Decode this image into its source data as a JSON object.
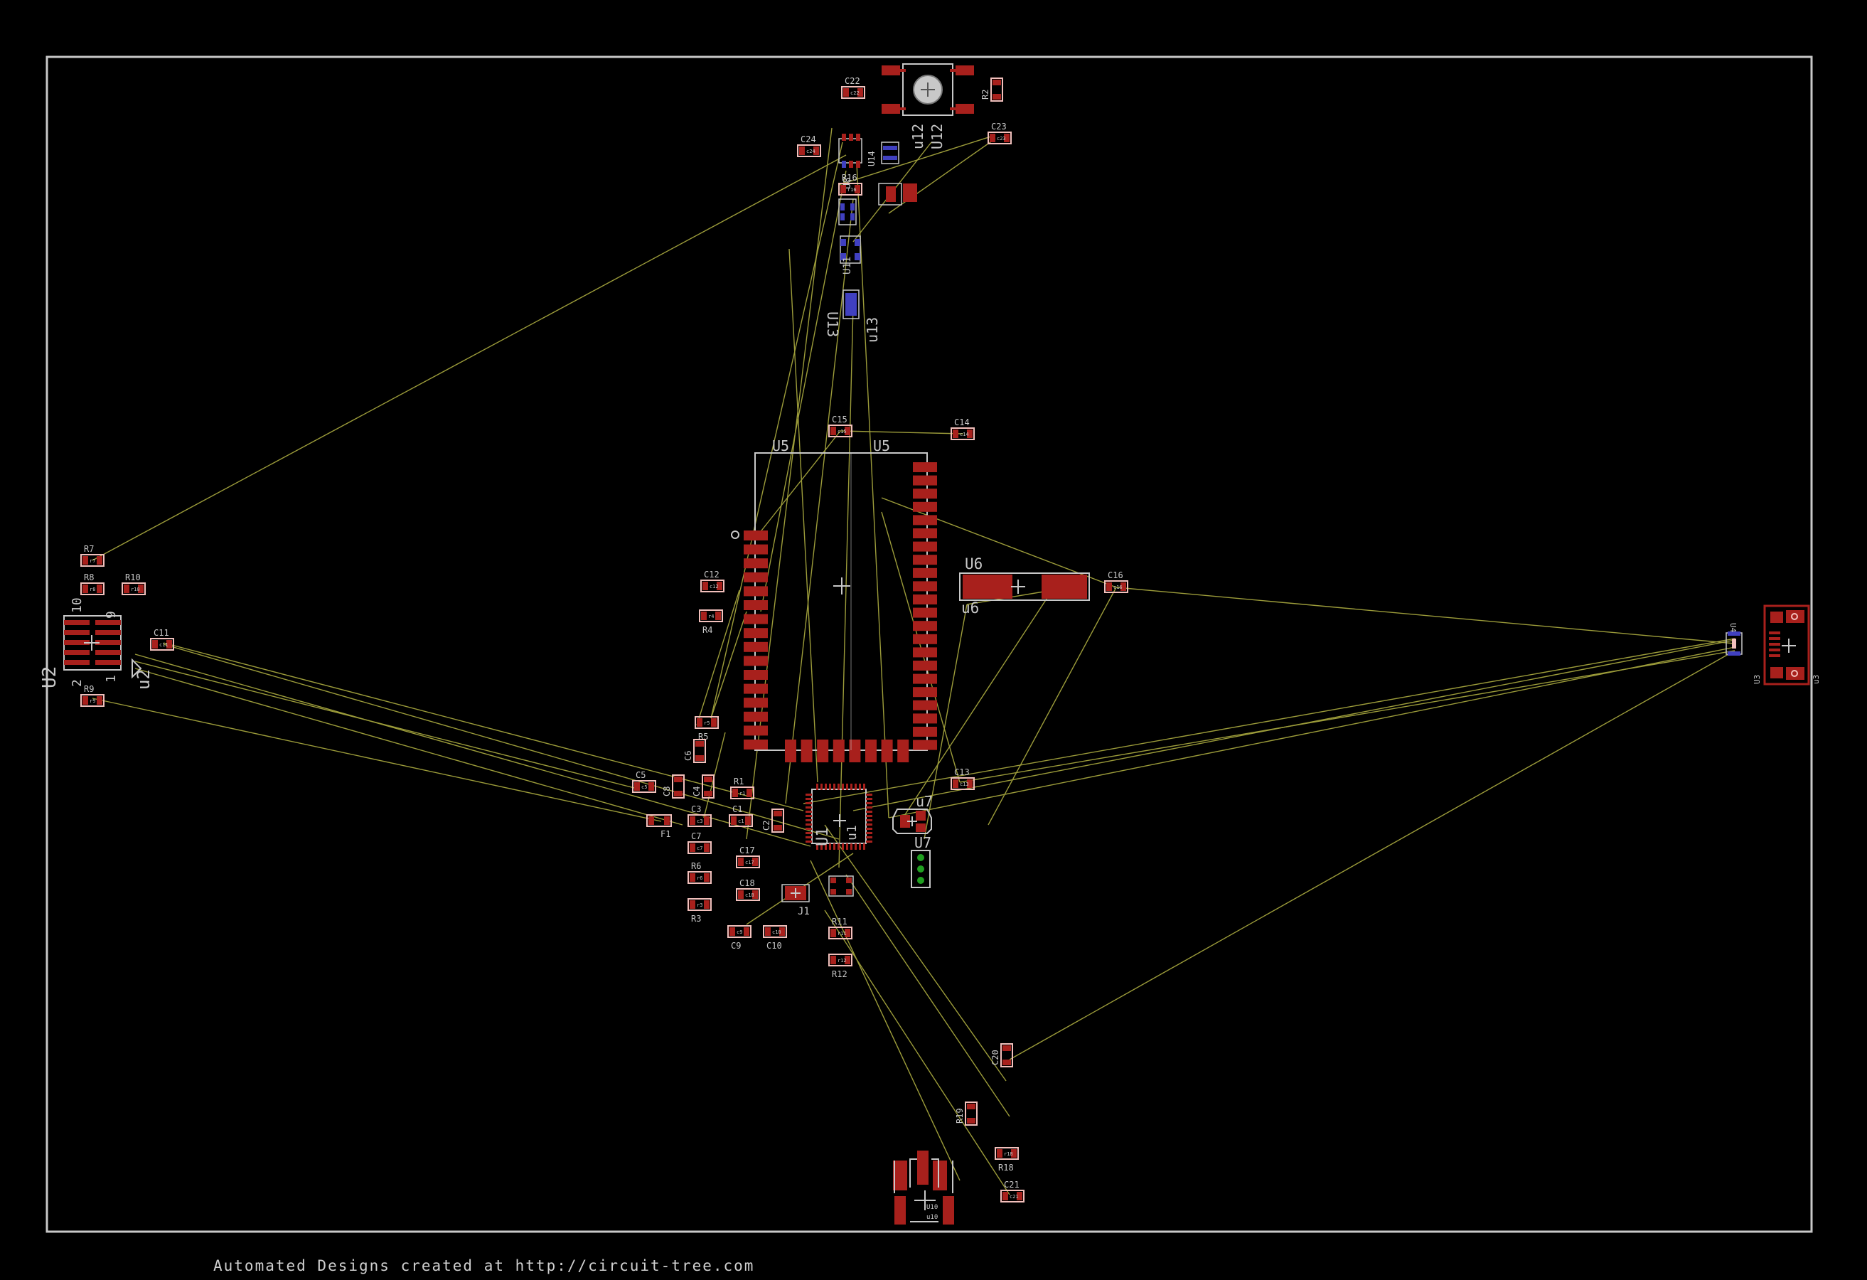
{
  "footer": "Automated Designs created at http://circuit-tree.com",
  "colors": {
    "background": "#000000",
    "outline": "#c8c8c8",
    "pad": "#a8201c",
    "pad_light": "#f2c0bc",
    "ratsnest": "#9c9c3a",
    "label": "#c8c8c8",
    "blue_pad": "#4040c0",
    "green_pad": "#20a020"
  },
  "components": {
    "U5": "U5",
    "U5_top": "U5",
    "U6": "U6",
    "u6": "u6",
    "U1": "U1",
    "u1": "u1",
    "U2": "U2",
    "u2": "u2",
    "U3": "U3",
    "u3": "u3",
    "U4": "U4",
    "U7": "U7",
    "u7": "u7",
    "U10": "U10",
    "u10": "u10",
    "U12": "U12",
    "u12": "u12",
    "U13": "U13",
    "u13": "u13",
    "U8": "U8",
    "U11": "U11",
    "U14": "U14",
    "J1": "J1",
    "F1": "F1",
    "pin10": "10",
    "pin9": "9",
    "pin2": "2",
    "pin1": "1"
  },
  "passives": [
    {
      "ref": "R7",
      "sub": "r7"
    },
    {
      "ref": "R8",
      "sub": "r8"
    },
    {
      "ref": "R10",
      "sub": "r10"
    },
    {
      "ref": "R9",
      "sub": "r9"
    },
    {
      "ref": "C11",
      "sub": "c11"
    },
    {
      "ref": "C22",
      "sub": "c22"
    },
    {
      "ref": "C24",
      "sub": "c24"
    },
    {
      "ref": "R2",
      "sub": "r2"
    },
    {
      "ref": "C23",
      "sub": "c23"
    },
    {
      "ref": "R16",
      "sub": "r16"
    },
    {
      "ref": "C15",
      "sub": "c15"
    },
    {
      "ref": "C14",
      "sub": "c14"
    },
    {
      "ref": "C12",
      "sub": "c12"
    },
    {
      "ref": "R4",
      "sub": "r4"
    },
    {
      "ref": "C16",
      "sub": "c16"
    },
    {
      "ref": "R5",
      "sub": "r5"
    },
    {
      "ref": "C6",
      "sub": "c6"
    },
    {
      "ref": "C5",
      "sub": "c5"
    },
    {
      "ref": "C4",
      "sub": "c4"
    },
    {
      "ref": "R1",
      "sub": "r1"
    },
    {
      "ref": "C3",
      "sub": "c3"
    },
    {
      "ref": "C1",
      "sub": "c1"
    },
    {
      "ref": "C2",
      "sub": "c2"
    },
    {
      "ref": "C7",
      "sub": "c7"
    },
    {
      "ref": "C17",
      "sub": "c17"
    },
    {
      "ref": "C18",
      "sub": "c18"
    },
    {
      "ref": "R6",
      "sub": "r6"
    },
    {
      "ref": "R3",
      "sub": "r3"
    },
    {
      "ref": "C9",
      "sub": "c9"
    },
    {
      "ref": "C10",
      "sub": "c10"
    },
    {
      "ref": "R11",
      "sub": "r11"
    },
    {
      "ref": "R12",
      "sub": "r12"
    },
    {
      "ref": "C13",
      "sub": "c13"
    },
    {
      "ref": "C20",
      "sub": "c20"
    },
    {
      "ref": "R19",
      "sub": "r19"
    },
    {
      "ref": "R18",
      "sub": "r18"
    },
    {
      "ref": "C21",
      "sub": "c21"
    },
    {
      "ref": "C8",
      "sub": "c8"
    }
  ]
}
